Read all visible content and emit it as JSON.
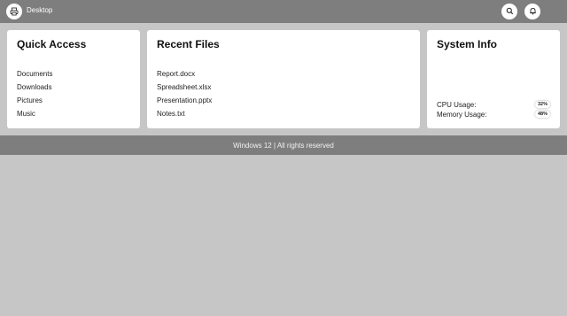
{
  "topbar": {
    "app_icon": "printer-icon",
    "title": "Desktop",
    "buttons": [
      {
        "icon": "search-icon"
      },
      {
        "icon": "bell-icon"
      }
    ]
  },
  "quick_access": {
    "title": "Quick Access",
    "items": [
      "Documents",
      "Downloads",
      "Pictures",
      "Music"
    ]
  },
  "recent_files": {
    "title": "Recent Files",
    "items": [
      "Report.docx",
      "Spreadsheet.xlsx",
      "Presentation.pptx",
      "Notes.txt"
    ]
  },
  "system_info": {
    "title": "System Info",
    "cpu_label": "CPU Usage:",
    "cpu_value": "32%",
    "memory_label": "Memory Usage:",
    "memory_value": "48%"
  },
  "footer": {
    "text": "Windows 12 | All rights reserved"
  },
  "colors": {
    "bar": "#7e7e7e",
    "background": "#c6c6c6",
    "card": "#ffffff"
  }
}
